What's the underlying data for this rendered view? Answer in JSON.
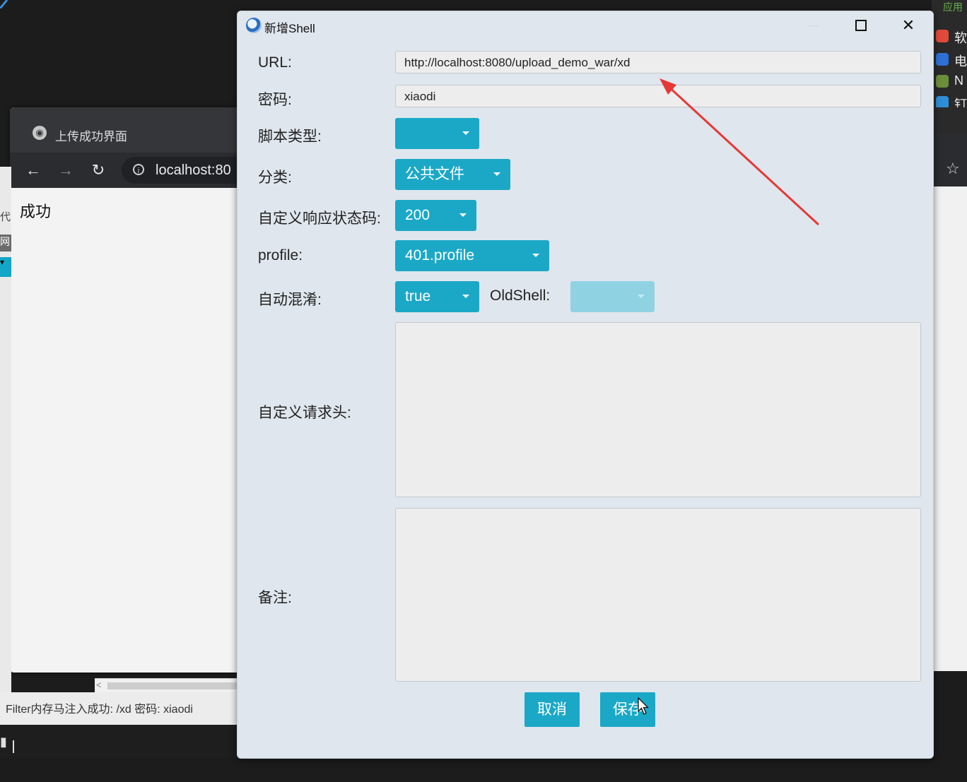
{
  "browser": {
    "tab_title": "上传成功界面",
    "tab_icon": "globe-icon",
    "nav": {
      "back": "←",
      "forward": "→",
      "reload": "↻",
      "info": "i"
    },
    "url": "localhost:80",
    "content_text": "成功",
    "status_text": "Filter内存马注入成功: /xd 密码: xiaodi",
    "scroll_left": "<"
  },
  "background": {
    "left_strip": [
      "代",
      "网",
      "▾"
    ],
    "right_top_label": "应用",
    "right_items": [
      {
        "icon": "app-icon",
        "color": "#e04a3a",
        "text": "软"
      },
      {
        "icon": "shield-icon",
        "color": "#2f6fd6",
        "text": "电"
      },
      {
        "icon": "folder-icon",
        "color": "#6b8f3a",
        "text": "N"
      },
      {
        "icon": "pin-icon",
        "color": "#2f8fd6",
        "text": "钉"
      }
    ],
    "bookmark_star": "☆",
    "taskbar_glyph": "▮"
  },
  "dialog": {
    "title": "新增Shell",
    "icon": "app-globe-icon",
    "controls": {
      "maximize": "maximize-icon",
      "close": "✕"
    },
    "labels": {
      "url": "URL:",
      "password": "密码:",
      "script_type": "脚本类型:",
      "category": "分类:",
      "status_code": "自定义响应状态码:",
      "profile": "profile:",
      "obfuscate": "自动混淆:",
      "old_shell": "OldShell:",
      "headers": "自定义请求头:",
      "remark": "备注:"
    },
    "values": {
      "url": "http://localhost:8080/upload_demo_war/xd",
      "password": "xiaodi",
      "script_type": "",
      "category": "公共文件",
      "status_code": "200",
      "profile": "401.profile",
      "obfuscate": "true",
      "old_shell": "",
      "headers": "",
      "remark": ""
    },
    "buttons": {
      "cancel": "取消",
      "save": "保存"
    }
  },
  "annotation": {
    "arrow_color": "#e53935"
  },
  "colors": {
    "accent": "#1ba8c7",
    "dialog_bg": "#dfe6ed"
  }
}
